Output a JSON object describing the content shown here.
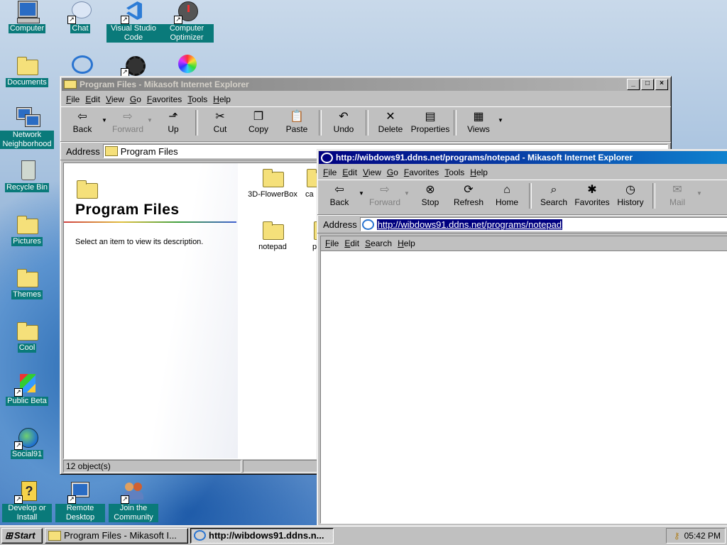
{
  "desktop": {
    "icons": [
      {
        "label": "Computer",
        "icon": "computer-icon"
      },
      {
        "label": "Chat",
        "icon": "chat-icon"
      },
      {
        "label": "Visual Studio Code",
        "icon": "vscode-icon"
      },
      {
        "label": "Computer Optimizer",
        "icon": "optimizer-icon"
      },
      {
        "label": "Documents",
        "icon": "folder-icon"
      },
      {
        "label": "Network Neighborhood",
        "icon": "network-icon"
      },
      {
        "label": "Recycle Bin",
        "icon": "recycle-bin-icon"
      },
      {
        "label": "Pictures",
        "icon": "folder-icon"
      },
      {
        "label": "Themes",
        "icon": "folder-icon"
      },
      {
        "label": "Cool",
        "icon": "folder-icon"
      },
      {
        "label": "Public Beta",
        "icon": "public-beta-icon"
      },
      {
        "label": "Social91",
        "icon": "globe-icon"
      },
      {
        "label": "Develop or Install",
        "icon": "help-icon"
      },
      {
        "label": "Remote Desktop",
        "icon": "remote-desktop-icon"
      },
      {
        "label": "Join the Community",
        "icon": "community-icon"
      }
    ]
  },
  "explorer": {
    "title": "Program Files - Mikasoft Internet Explorer",
    "menu": [
      "File",
      "Edit",
      "View",
      "Go",
      "Favorites",
      "Tools",
      "Help"
    ],
    "toolbar": {
      "back": "Back",
      "forward": "Forward",
      "up": "Up",
      "cut": "Cut",
      "copy": "Copy",
      "paste": "Paste",
      "undo": "Undo",
      "delete": "Delete",
      "properties": "Properties",
      "views": "Views"
    },
    "address_label": "Address",
    "address_value": "Program Files",
    "panel_title": "Program Files",
    "panel_desc": "Select an item to view its description.",
    "files": [
      "3D-FlowerBox",
      "ca",
      "notepad",
      "p"
    ],
    "status": "12 object(s)"
  },
  "browser": {
    "title": "http://wibdows91.ddns.net/programs/notepad - Mikasoft Internet Explorer",
    "menu": [
      "File",
      "Edit",
      "View",
      "Go",
      "Favorites",
      "Tools",
      "Help"
    ],
    "toolbar": {
      "back": "Back",
      "forward": "Forward",
      "stop": "Stop",
      "refresh": "Refresh",
      "home": "Home",
      "search": "Search",
      "favorites": "Favorites",
      "history": "History",
      "mail": "Mail"
    },
    "address_label": "Address",
    "address_value": "http://wibdows91.ddns.net/programs/notepad",
    "notepad_menu": [
      "File",
      "Edit",
      "Search",
      "Help"
    ]
  },
  "taskbar": {
    "start": "Start",
    "tasks": [
      "Program Files - Mikasoft I...",
      "http://wibdows91.ddns.n..."
    ],
    "clock": "05:42 PM"
  }
}
